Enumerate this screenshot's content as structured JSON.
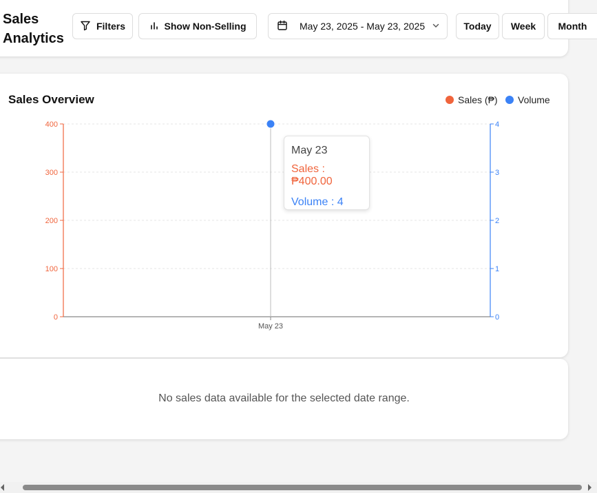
{
  "header": {
    "title": "Sales Analytics",
    "filters_label": "Filters",
    "show_non_selling_label": "Show Non-Selling",
    "date_range": "May 23, 2025 - May 23, 2025",
    "today_label": "Today",
    "week_label": "Week",
    "month_label": "Month"
  },
  "chart_panel": {
    "title": "Sales Overview",
    "legend_sales": "Sales (₱)",
    "legend_volume": "Volume",
    "tooltip": {
      "date": "May 23",
      "sales": "Sales : ₱400.00",
      "volume": "Volume : 4"
    }
  },
  "empty_message": "No sales data available for the selected date range.",
  "colors": {
    "sales": "#f0643c",
    "volume": "#3b82f6"
  },
  "chart_data": {
    "type": "line",
    "x": [
      "May 23"
    ],
    "series": [
      {
        "name": "Sales (₱)",
        "axis": "left",
        "values": [
          400
        ]
      },
      {
        "name": "Volume",
        "axis": "right",
        "values": [
          4
        ]
      }
    ],
    "y_left_ticks": [
      "0",
      "100",
      "200",
      "300",
      "400"
    ],
    "y_right_ticks": [
      "0",
      "1",
      "2",
      "3",
      "4"
    ],
    "ylim_left": [
      0,
      400
    ],
    "ylim_right": [
      0,
      4
    ],
    "grid": true,
    "legend": "top-right"
  }
}
